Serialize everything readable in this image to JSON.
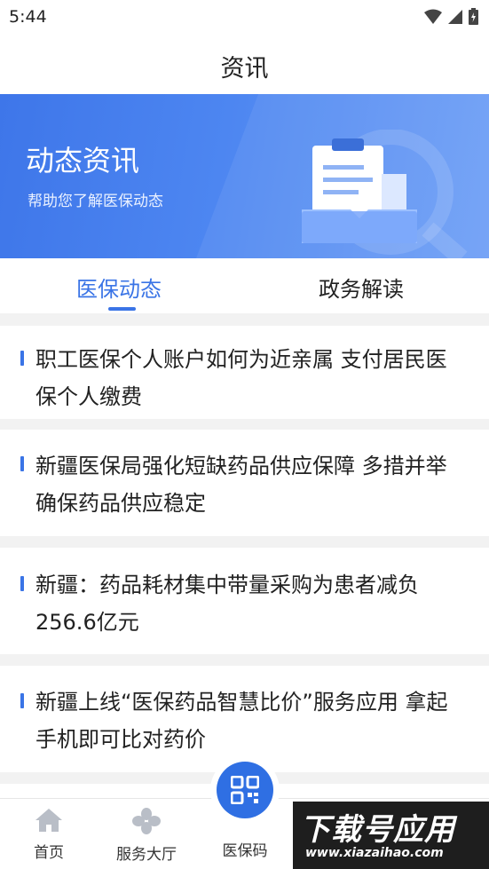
{
  "status_bar": {
    "time": "5:44"
  },
  "header": {
    "title": "资讯"
  },
  "banner": {
    "title": "动态资讯",
    "subtitle": "帮助您了解医保动态"
  },
  "tabs": [
    {
      "label": "医保动态",
      "active": true
    },
    {
      "label": "政务解读",
      "active": false
    }
  ],
  "news": [
    {
      "title": "职工医保个人账户如何为近亲属 支付居民医保个人缴费"
    },
    {
      "title": "新疆医保局强化短缺药品供应保障 多措并举确保药品供应稳定"
    },
    {
      "title": "新疆：药品耗材集中带量采购为患者减负256.6亿元"
    },
    {
      "title": "新疆上线“医保药品智慧比价”服务应用 拿起手机即可比对药价"
    }
  ],
  "bottom_nav": {
    "home": "首页",
    "service_hall": "服务大厅",
    "qr_code": "医保码"
  },
  "watermark": {
    "main": "下载号应用",
    "sub": "www.xiazaihao.com"
  },
  "colors": {
    "accent": "#3a74e6",
    "banner": "#4d86f1"
  }
}
